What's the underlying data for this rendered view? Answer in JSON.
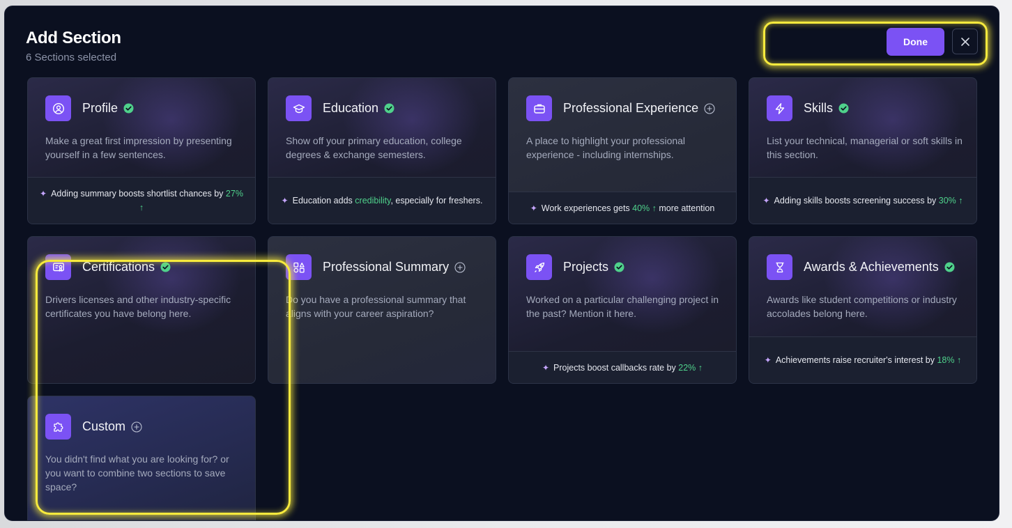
{
  "modal": {
    "title": "Add Section",
    "subtitle": "6 Sections selected",
    "done_label": "Done",
    "close_icon": "close-icon"
  },
  "colors": {
    "accent": "#7b52f4",
    "check": "#4fd18b",
    "highlight": "#f7ea3d",
    "background": "#0b1020"
  },
  "cards": [
    {
      "title": "Profile",
      "icon": "user-circle-icon",
      "status": "selected",
      "desc": "Make a great first impression by presenting yourself in a few sentences.",
      "tip_pre": "Adding summary boosts shortlist chances by",
      "tip_hl": "27% ↑",
      "tip_post": ""
    },
    {
      "title": "Education",
      "icon": "graduation-cap-icon",
      "status": "selected",
      "desc": "Show off your primary education, college degrees & exchange semesters.",
      "tip_pre": "Education adds",
      "tip_hl": "credibility",
      "tip_post": ", especially for freshers."
    },
    {
      "title": "Professional Experience",
      "icon": "briefcase-icon",
      "status": "add",
      "desc": "A place to highlight your professional experience - including internships.",
      "tip_pre": "Work experiences gets",
      "tip_hl": "40% ↑",
      "tip_post": "more attention"
    },
    {
      "title": "Skills",
      "icon": "lightning-icon",
      "status": "selected",
      "desc": "List your technical, managerial or soft skills in this section.",
      "tip_pre": "Adding skills boosts screening success by",
      "tip_hl": "30% ↑",
      "tip_post": ""
    },
    {
      "title": "Certifications",
      "icon": "certificate-icon",
      "status": "selected",
      "desc": "Drivers licenses and other industry-specific certificates you have belong here."
    },
    {
      "title": "Professional Summary",
      "icon": "shapes-icon",
      "status": "add",
      "desc": "Do you have a professional summary that aligns with your career aspiration?"
    },
    {
      "title": "Projects",
      "icon": "rocket-icon",
      "status": "selected",
      "desc": "Worked on a particular challenging project in the past? Mention it here.",
      "tip_pre": "Projects boost callbacks rate by",
      "tip_hl": "22% ↑",
      "tip_post": ""
    },
    {
      "title": "Awards & Achievements",
      "icon": "trophy-icon",
      "status": "selected",
      "desc": "Awards like student competitions or industry accolades belong here.",
      "tip_pre": "Achievements raise recruiter's interest by",
      "tip_hl": "18% ↑",
      "tip_post": ""
    },
    {
      "title": "Custom",
      "icon": "puzzle-icon",
      "status": "add",
      "desc": "You didn't find what you are looking for? or you want to combine two sections to save space?"
    }
  ]
}
